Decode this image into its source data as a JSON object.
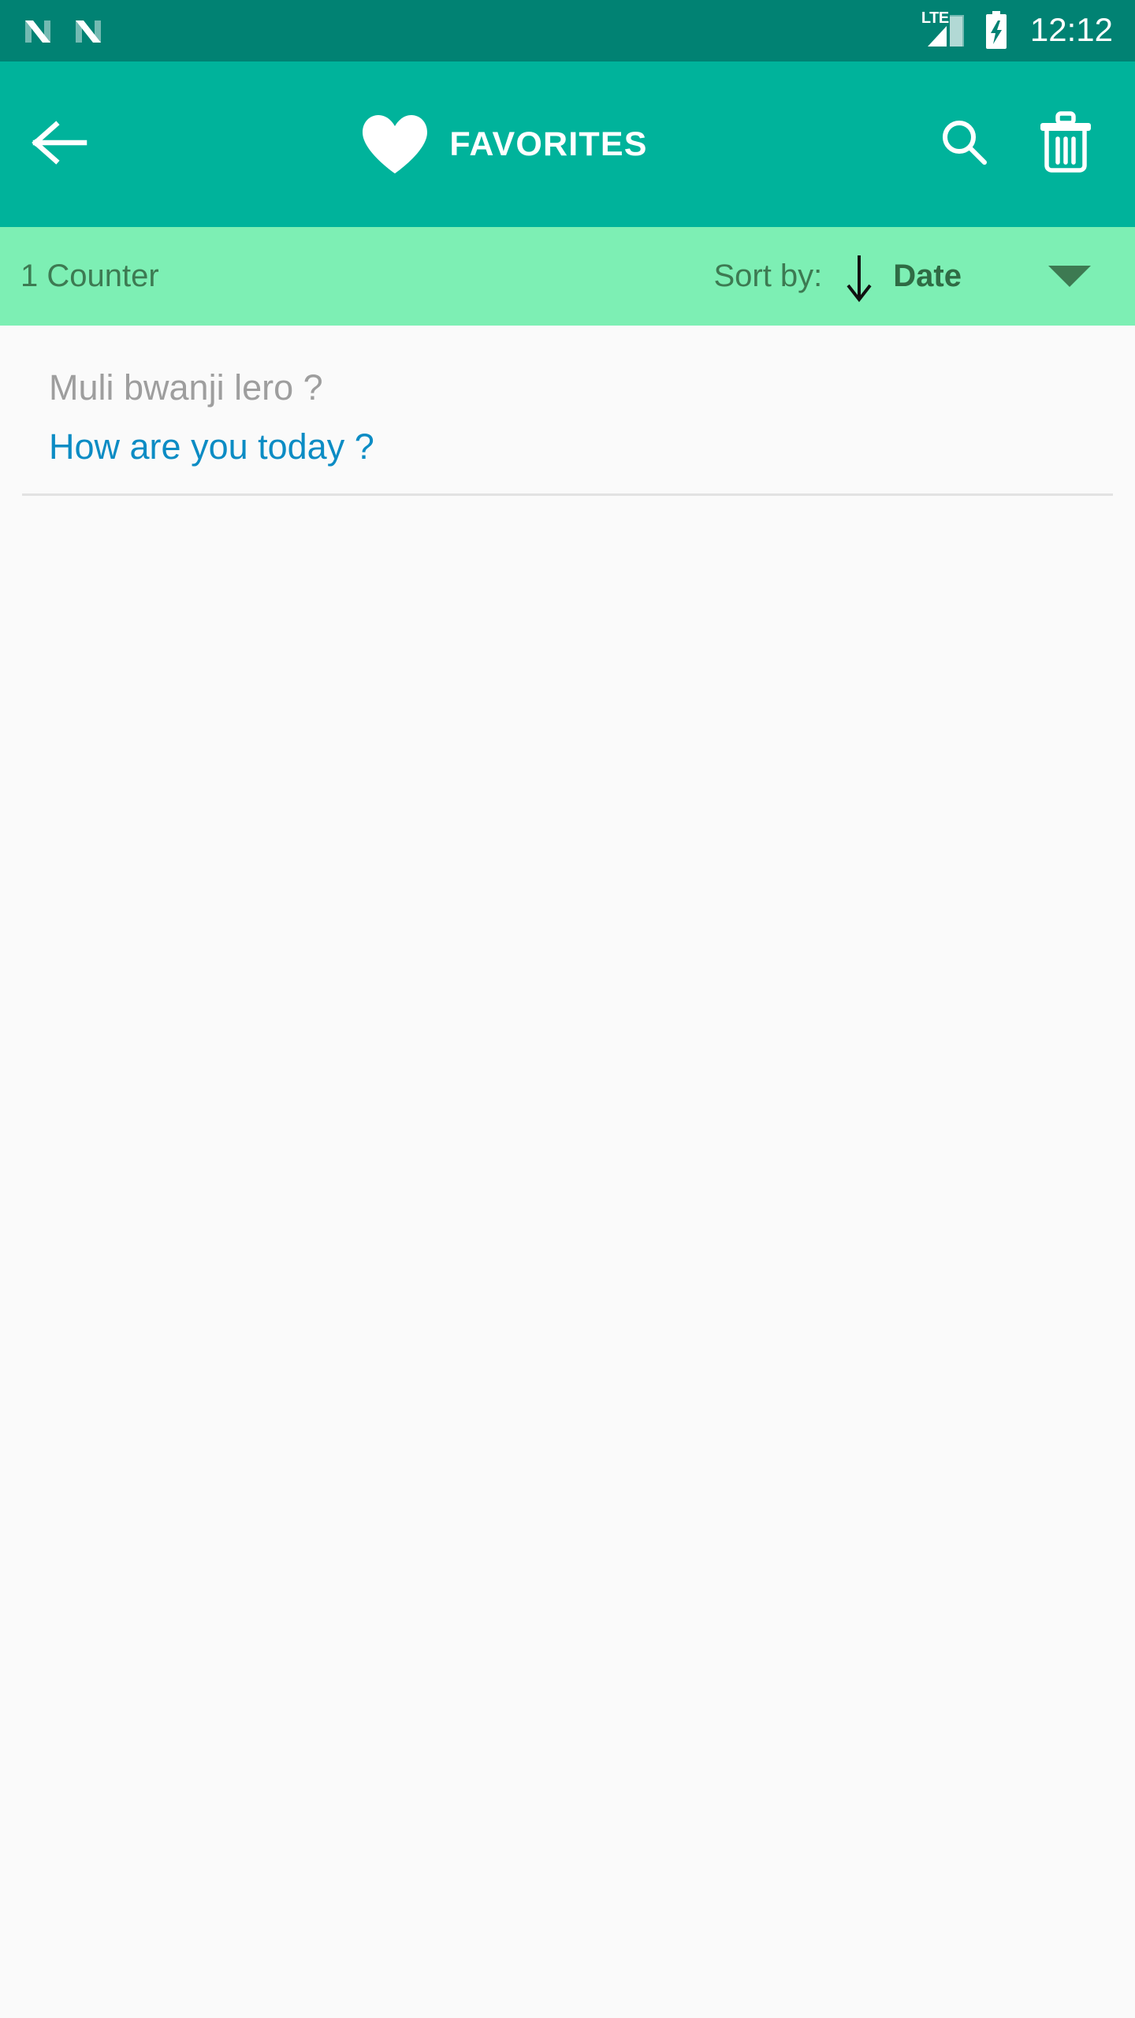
{
  "status_bar": {
    "notification_icons": [
      "android-nougat-icon",
      "android-nougat-icon"
    ],
    "network_label": "LTE",
    "signal_icon": "signal-bars-icon",
    "battery_icon": "battery-charging-icon",
    "time": "12:12",
    "background_color": "#018273"
  },
  "app_bar": {
    "back_icon": "back-arrow-icon",
    "brand_icon": "heart-icon",
    "title": "FAVORITES",
    "search_icon": "search-icon",
    "delete_icon": "trash-icon",
    "background_color": "#00b39b",
    "text_color": "#ffffff"
  },
  "sort_bar": {
    "counter_label": "1 Counter",
    "sort_label": "Sort by:",
    "sort_direction_icon": "arrow-down-icon",
    "sort_value": "Date",
    "dropdown_icon": "caret-down-icon",
    "background_color": "#7defb4",
    "text_color": "#3d7a52"
  },
  "list": {
    "items": [
      {
        "source_text": "Muli bwanji lero ?",
        "translation_text": "How are you today ?",
        "source_color": "#9e9e9e",
        "translation_color": "#0c8cc4"
      }
    ],
    "background_color": "#fafafa"
  }
}
